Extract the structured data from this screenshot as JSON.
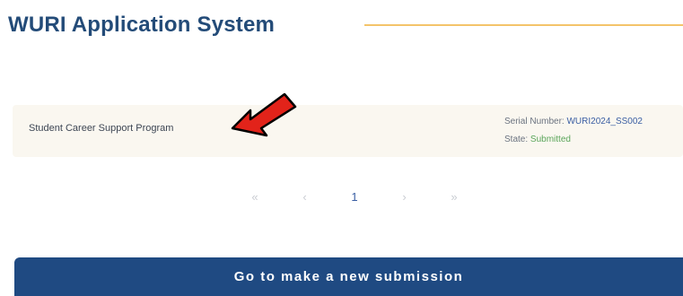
{
  "header": {
    "title": "WURI Application System",
    "accent_color": "#f4c46a",
    "title_color": "#234b78"
  },
  "submission": {
    "program_name": "Student Career Support Program",
    "serial_label": "Serial Number:",
    "serial_value": "WURI2024_SS002",
    "state_label": "State:",
    "state_value": "Submitted",
    "state_color": "#5aa55a",
    "annotation_icon": "red-arrow-icon"
  },
  "pagination": {
    "first": "«",
    "prev": "‹",
    "current_page": "1",
    "next": "›",
    "last": "»"
  },
  "actions": {
    "new_submission_label": "Go to make a new submission",
    "button_color": "#1f4a82"
  }
}
